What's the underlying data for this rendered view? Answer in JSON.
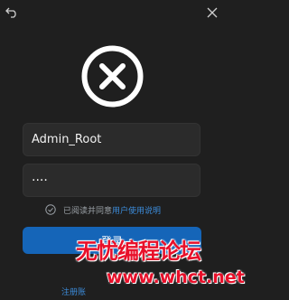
{
  "window": {
    "back_icon": "back-arrow-icon",
    "close_icon": "close-icon"
  },
  "logo": {
    "icon": "circle-x-icon"
  },
  "username": {
    "value": "Admin_Root"
  },
  "password": {
    "value": "····"
  },
  "agreement": {
    "text": "已阅读并同意",
    "link": "用户使用说明",
    "check_icon": "circle-check-icon"
  },
  "login_button": {
    "label": "登录"
  },
  "register_link": {
    "label": "注册账"
  },
  "watermark": {
    "title": "无忧编程论坛",
    "url": "www.whct.net"
  },
  "colors": {
    "background": "#1f1f1f",
    "field": "#2b2b2b",
    "primary": "#1565b8",
    "link": "#3c8cdb",
    "watermark": "#e8102a"
  }
}
